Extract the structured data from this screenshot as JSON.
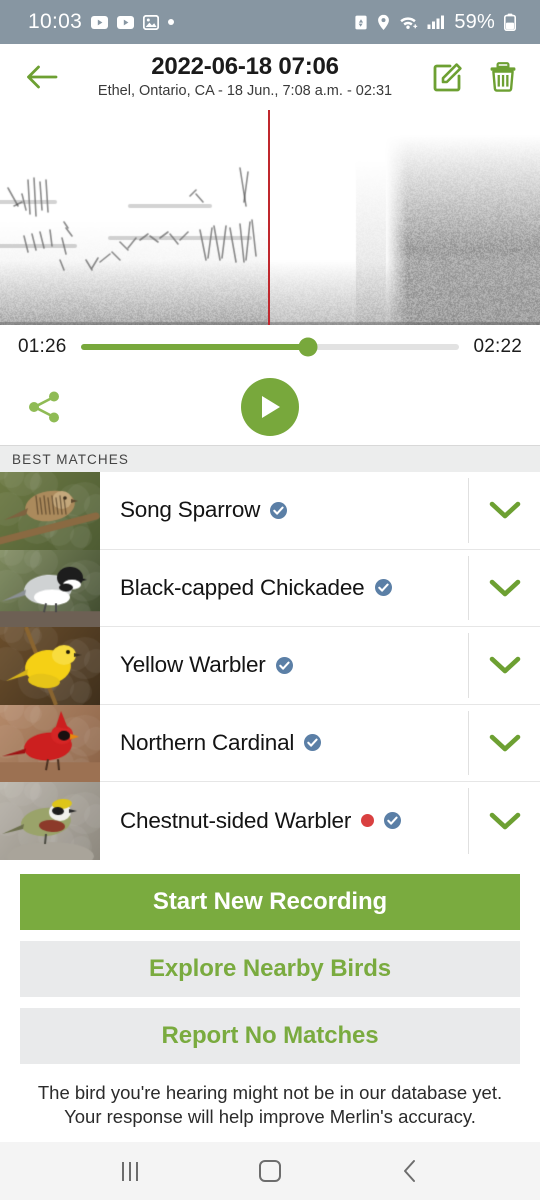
{
  "status_bar": {
    "time": "10:03",
    "battery": "59%",
    "icons": [
      "youtube-icon",
      "youtube-icon",
      "image-icon",
      "dot-icon"
    ],
    "right_icons": [
      "data-saver-icon",
      "location-icon",
      "wifi-icon",
      "cellular-signal-icon",
      "battery-icon"
    ],
    "background_color": "#8796a2"
  },
  "header": {
    "back_label": "back-arrow",
    "title": "2022-06-18 07:06",
    "subtitle": "Ethel, Ontario, CA - 18 Jun., 7:08 a.m. - 02:31",
    "edit_label": "edit-icon",
    "delete_label": "trash-icon"
  },
  "player": {
    "current_time": "01:26",
    "total_time": "02:22",
    "progress_percent": 60,
    "playhead_percent": 49.6,
    "share_label": "share-icon",
    "play_label": "play-icon"
  },
  "matches": {
    "section_label": "BEST MATCHES",
    "rows": [
      {
        "name": "Song Sparrow",
        "verified": true,
        "new_marker": false,
        "thumb": "song-sparrow-photo"
      },
      {
        "name": "Black-capped Chickadee",
        "verified": true,
        "new_marker": false,
        "thumb": "black-capped-chickadee-photo"
      },
      {
        "name": "Yellow Warbler",
        "verified": true,
        "new_marker": false,
        "thumb": "yellow-warbler-photo"
      },
      {
        "name": "Northern Cardinal",
        "verified": true,
        "new_marker": false,
        "thumb": "northern-cardinal-photo"
      },
      {
        "name": "Chestnut-sided Warbler",
        "verified": true,
        "new_marker": true,
        "thumb": "chestnut-sided-warbler-photo"
      }
    ]
  },
  "actions": {
    "primary": "Start New Recording",
    "secondary_1": "Explore Nearby Birds",
    "secondary_2": "Report No Matches",
    "footnote": "The bird you're hearing might not be in our database yet. Your response will help improve Merlin's accuracy."
  },
  "nav_bar": {
    "recents": "recents-icon",
    "home": "home-icon",
    "back": "back-nav-icon"
  },
  "colors": {
    "accent_green": "#7aab3f",
    "playhead_red": "#c0272d",
    "badge_blue": "#5b7fa6",
    "new_dot_red": "#d94040"
  }
}
